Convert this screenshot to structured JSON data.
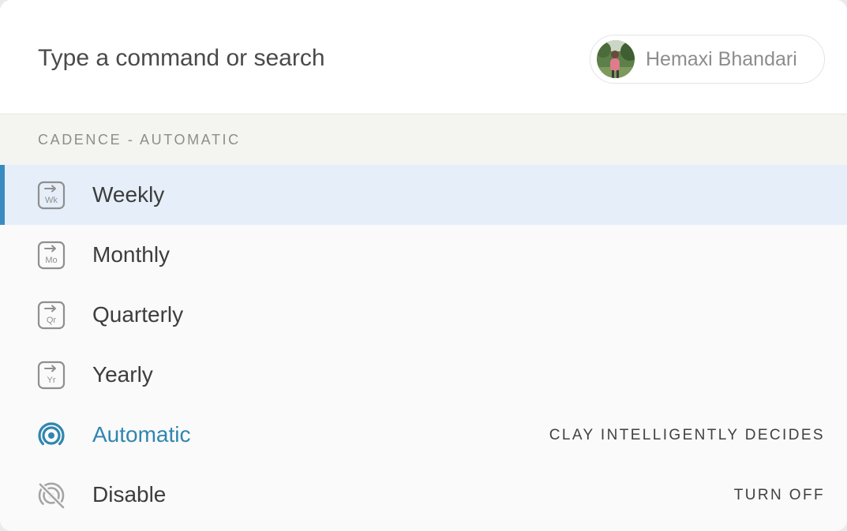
{
  "search": {
    "placeholder": "Type a command or search"
  },
  "user": {
    "name": "Hemaxi Bhandari"
  },
  "section": {
    "title": "CADENCE - AUTOMATIC"
  },
  "items": [
    {
      "label": "Weekly",
      "icon": "calendar-weekly-icon",
      "icon_text": "Wk",
      "selected": true
    },
    {
      "label": "Monthly",
      "icon": "calendar-monthly-icon",
      "icon_text": "Mo"
    },
    {
      "label": "Quarterly",
      "icon": "calendar-quarterly-icon",
      "icon_text": "Qr"
    },
    {
      "label": "Yearly",
      "icon": "calendar-yearly-icon",
      "icon_text": "Yr"
    },
    {
      "label": "Automatic",
      "icon": "broadcast-icon",
      "hint": "CLAY INTELLIGENTLY DECIDES",
      "accent": true
    },
    {
      "label": "Disable",
      "icon": "broadcast-off-icon",
      "hint": "TURN OFF"
    }
  ],
  "colors": {
    "accent": "#2f86b0",
    "selected_bg": "#e6eef9",
    "selected_bar": "#3a8bbf",
    "section_bg": "#f4f4f0"
  }
}
